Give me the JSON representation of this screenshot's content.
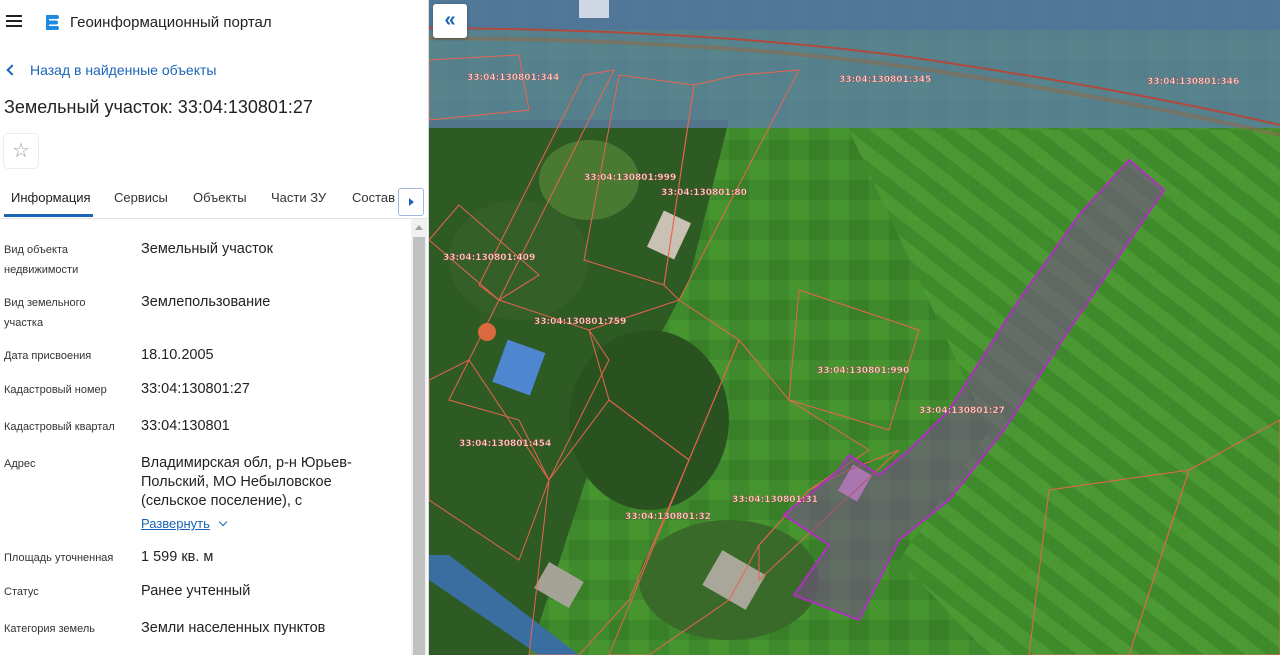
{
  "header": {
    "app_title": "Геоинформационный портал",
    "menu_icon": "hamburger-icon",
    "logo_icon": "portal-logo-icon"
  },
  "nav": {
    "back_label": "Назад в найденные объекты"
  },
  "object": {
    "title": "Земельный участок: 33:04:130801:27"
  },
  "tabs": [
    {
      "label": "Информация",
      "active": true
    },
    {
      "label": "Сервисы"
    },
    {
      "label": "Объекты"
    },
    {
      "label": "Части ЗУ"
    },
    {
      "label": "Состав"
    }
  ],
  "fields": [
    {
      "label": "Вид объекта недвижимости",
      "value": "Земельный участок"
    },
    {
      "label": "Вид земельного участка",
      "value": "Землепользование"
    },
    {
      "label": "Дата присвоения",
      "value": "18.10.2005"
    },
    {
      "label": "Кадастровый номер",
      "value": "33:04:130801:27"
    },
    {
      "label": "Кадастровый квартал",
      "value": "33:04:130801"
    },
    {
      "label": "Адрес",
      "value": "Владимирская обл, р-н Юрьев-Польский, МО Небыловское (сельское поселение), с",
      "expand_label": "Развернуть"
    },
    {
      "label": "Площадь уточненная",
      "value": "1 599 кв. м"
    },
    {
      "label": "Статус",
      "value": "Ранее учтенный"
    },
    {
      "label": "Категория земель",
      "value": "Земли населенных пунктов"
    }
  ],
  "map": {
    "collapse_icon": "double-chevron-left-icon",
    "parcels": [
      "33:04:130801:344",
      "33:04:130801:345",
      "33:04:130801:346",
      "33:04:130801:999",
      "33:04:130801:80",
      "33:04:130801:409",
      "33:04:130801:759",
      "33:04:130801:990",
      "33:04:130801:27",
      "33:04:130801:454",
      "33:04:130801:31",
      "33:04:130801:32"
    ],
    "highlight_color": "#b02fc0",
    "boundary_color": "#e8654f"
  }
}
